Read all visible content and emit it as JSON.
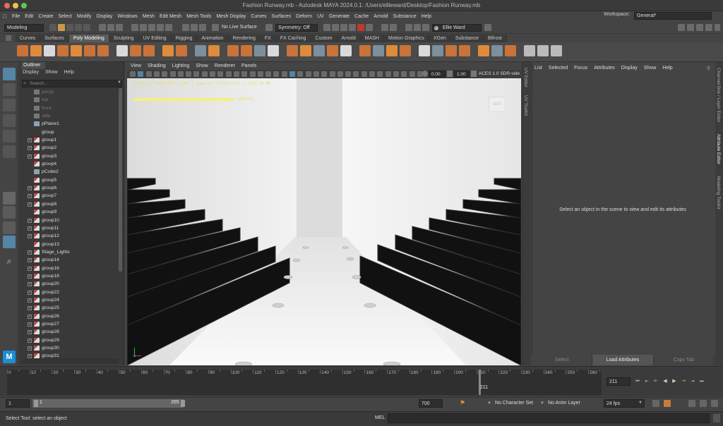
{
  "window": {
    "title": "Fashion Runway.mb - Autodesk MAYA 2024.0.1: /Users/ellieward/Desktop/Fashion Runway.mb"
  },
  "menu": [
    "File",
    "Edit",
    "Create",
    "Select",
    "Modify",
    "Display",
    "Windows",
    "Mesh",
    "Edit Mesh",
    "Mesh Tools",
    "Mesh Display",
    "Curves",
    "Surfaces",
    "Deform",
    "UV",
    "Generate",
    "Cache",
    "Arnold",
    "Substance",
    "Help"
  ],
  "workspace": {
    "label": "Workspace:",
    "value": "General*"
  },
  "statusline": {
    "mode": "Modeling",
    "live_surface": "No Live Surface",
    "symmetry": "Symmetry: Off",
    "user": "Ellie Ward"
  },
  "shelf_tabs": [
    "Curves",
    "Surfaces",
    "Poly Modeling",
    "Sculpting",
    "UV Editing",
    "Rigging",
    "Animation",
    "Rendering",
    "FX",
    "FX Caching",
    "Custom",
    "Arnold",
    "MASH",
    "Motion Graphics",
    "XGen",
    "Substance",
    "Bifrost"
  ],
  "shelf_active": "Poly Modeling",
  "outliner": {
    "tab": "Outliner",
    "menu": [
      "Display",
      "Show",
      "Help"
    ],
    "search_placeholder": "Search...",
    "items": [
      {
        "name": "persp",
        "dim": true,
        "expand": false,
        "icon": "camera"
      },
      {
        "name": "top",
        "dim": true,
        "expand": false,
        "icon": "camera"
      },
      {
        "name": "front",
        "dim": true,
        "expand": false,
        "icon": "camera"
      },
      {
        "name": "side",
        "dim": true,
        "expand": false,
        "icon": "camera"
      },
      {
        "name": "pPlane1",
        "dim": false,
        "expand": false,
        "icon": "mesh"
      },
      {
        "name": "group",
        "dim": false,
        "expand": false,
        "icon": "none"
      },
      {
        "name": "group1",
        "dim": false,
        "expand": true,
        "icon": "group"
      },
      {
        "name": "group2",
        "dim": false,
        "expand": true,
        "icon": "group"
      },
      {
        "name": "group3",
        "dim": false,
        "expand": true,
        "icon": "group"
      },
      {
        "name": "group4",
        "dim": false,
        "expand": false,
        "icon": "group"
      },
      {
        "name": "pCube2",
        "dim": false,
        "expand": false,
        "icon": "mesh"
      },
      {
        "name": "group5",
        "dim": false,
        "expand": false,
        "icon": "group"
      },
      {
        "name": "group6",
        "dim": false,
        "expand": true,
        "icon": "group"
      },
      {
        "name": "group7",
        "dim": false,
        "expand": true,
        "icon": "group"
      },
      {
        "name": "group8",
        "dim": false,
        "expand": true,
        "icon": "group"
      },
      {
        "name": "group9",
        "dim": false,
        "expand": false,
        "icon": "group"
      },
      {
        "name": "group10",
        "dim": false,
        "expand": true,
        "icon": "group"
      },
      {
        "name": "group11",
        "dim": false,
        "expand": true,
        "icon": "group"
      },
      {
        "name": "group12",
        "dim": false,
        "expand": true,
        "icon": "group"
      },
      {
        "name": "group13",
        "dim": false,
        "expand": false,
        "icon": "group"
      },
      {
        "name": "Stage_Lights",
        "dim": false,
        "expand": true,
        "icon": "group"
      },
      {
        "name": "group14",
        "dim": false,
        "expand": true,
        "icon": "group"
      },
      {
        "name": "group16",
        "dim": false,
        "expand": true,
        "icon": "group"
      },
      {
        "name": "group18",
        "dim": false,
        "expand": true,
        "icon": "group"
      },
      {
        "name": "group20",
        "dim": false,
        "expand": true,
        "icon": "group"
      },
      {
        "name": "group22",
        "dim": false,
        "expand": true,
        "icon": "group"
      },
      {
        "name": "group24",
        "dim": false,
        "expand": true,
        "icon": "group"
      },
      {
        "name": "group25",
        "dim": false,
        "expand": true,
        "icon": "group"
      },
      {
        "name": "group26",
        "dim": false,
        "expand": true,
        "icon": "group"
      },
      {
        "name": "group27",
        "dim": false,
        "expand": true,
        "icon": "group"
      },
      {
        "name": "group28",
        "dim": false,
        "expand": true,
        "icon": "group"
      },
      {
        "name": "group29",
        "dim": false,
        "expand": true,
        "icon": "group"
      },
      {
        "name": "group30",
        "dim": false,
        "expand": true,
        "icon": "group"
      },
      {
        "name": "group31",
        "dim": false,
        "expand": true,
        "icon": "group"
      }
    ]
  },
  "viewport": {
    "menu": [
      "View",
      "Shading",
      "Lighting",
      "Show",
      "Renderer",
      "Panels"
    ],
    "exposure": "0.00",
    "gamma": "1.00",
    "colorspace": "ACES 1.0 SDR-vide",
    "hud_stats": "00:01:02 1960x1426 | CPU | samples 3/2/2/2/2/2 | 1114.38 MB",
    "progress_text": "100.00%",
    "progress": 1.0,
    "cube_label": "LEFT"
  },
  "side_tabs_left": [
    "UV Editor",
    "UV Toolkit"
  ],
  "attribute_editor": {
    "menu": [
      "List",
      "Selected",
      "Focus",
      "Attributes",
      "Display",
      "Show",
      "Help"
    ],
    "message": "Select an object in the scene to view and edit its attributes",
    "buttons": [
      "Select",
      "Load Attributes",
      "Copy Tab"
    ]
  },
  "side_tabs_right": [
    "Channel Box / Layer Editor",
    "Attribute Editor",
    "Modeling Toolkit"
  ],
  "timeline": {
    "ticks": [
      "0",
      "10",
      "20",
      "30",
      "40",
      "50",
      "60",
      "70",
      "80",
      "90",
      "100",
      "110",
      "120",
      "130",
      "140",
      "150",
      "160",
      "170",
      "180",
      "190",
      "200",
      "210",
      "220",
      "230",
      "240",
      "250",
      "260"
    ],
    "tick_values": [
      0,
      10,
      20,
      30,
      40,
      50,
      60,
      70,
      80,
      90,
      100,
      110,
      120,
      130,
      140,
      150,
      160,
      170,
      180,
      190,
      200,
      210,
      220,
      230,
      240,
      250,
      260
    ],
    "current_frame": "211",
    "current_frame_value": 211,
    "current_field": "211"
  },
  "range": {
    "start": "1",
    "start2": "1",
    "end_inner": "265",
    "end": "700",
    "character_set": "No Character Set",
    "anim_layer": "No Anim Layer",
    "fps": "24 fps"
  },
  "command": {
    "help_text": "Select Tool: select an object",
    "lang": "MEL"
  },
  "colors": {
    "accent": "#e08a3c",
    "select_blue": "#5285a6",
    "hud_yellow": "#f5f07a"
  }
}
